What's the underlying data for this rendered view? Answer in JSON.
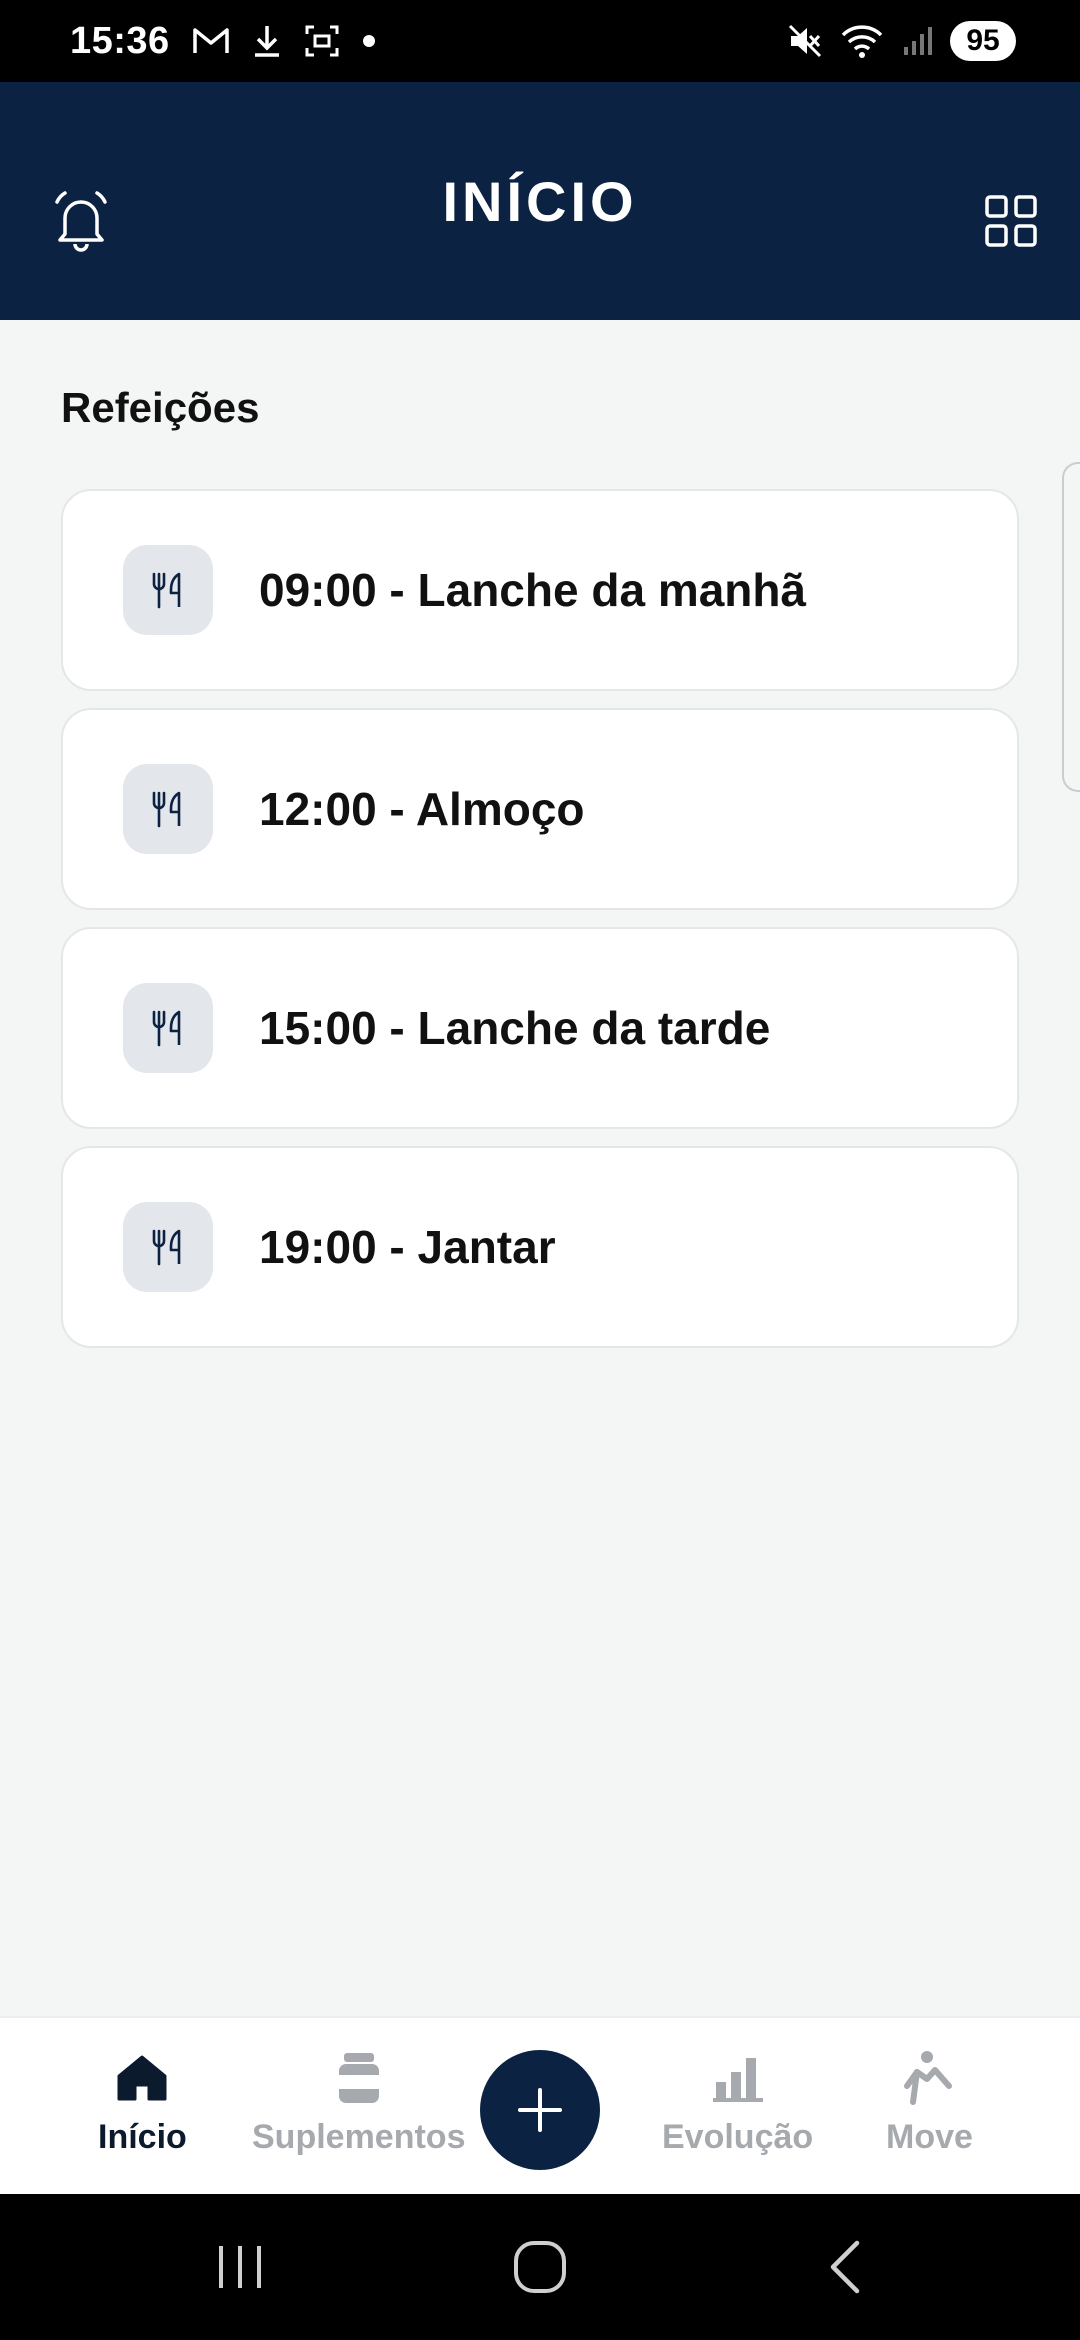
{
  "status_bar": {
    "time": "15:36",
    "battery": "95",
    "icons": [
      "gmail-icon",
      "download-icon",
      "screenshot-icon",
      "dot-icon",
      "mute-icon",
      "wifi-icon",
      "signal-icon"
    ]
  },
  "header": {
    "title": "INÍCIO",
    "left_icon": "bell-icon",
    "right_icon": "grid-icon",
    "background": "#0c2243"
  },
  "section": {
    "title": "Refeições"
  },
  "meals": [
    {
      "label": "09:00 - Lanche da manhã",
      "icon": "fork-knife-icon"
    },
    {
      "label": "12:00 - Almoço",
      "icon": "fork-knife-icon"
    },
    {
      "label": "15:00 - Lanche da tarde",
      "icon": "fork-knife-icon"
    },
    {
      "label": "19:00 - Jantar",
      "icon": "fork-knife-icon"
    }
  ],
  "bottom_nav": {
    "items": [
      {
        "label": "Início",
        "icon": "home-icon",
        "active": true
      },
      {
        "label": "Suplementos",
        "icon": "supplement-jar-icon",
        "active": false
      },
      {
        "label": "Evolução",
        "icon": "bar-chart-icon",
        "active": false
      },
      {
        "label": "Move",
        "icon": "exercise-icon",
        "active": false
      }
    ],
    "fab_icon": "plus-icon"
  },
  "system_nav": {
    "buttons": [
      "recents-icon",
      "home-circle-icon",
      "back-icon"
    ]
  },
  "colors": {
    "primary": "#0c2243",
    "background": "#f4f5f5",
    "card": "#ffffff",
    "icon_box": "#e3e6ea",
    "inactive": "#a6a9ad"
  }
}
